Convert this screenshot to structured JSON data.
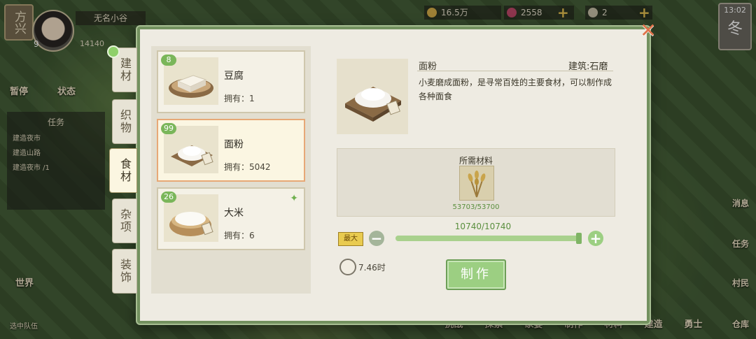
{
  "hud": {
    "season_left": "方兴",
    "player_name": "无名小谷",
    "level": "9",
    "coins_left": "14140",
    "resources": [
      {
        "value": "16.5万",
        "color": "#d9b04a"
      },
      {
        "value": "2558",
        "color": "#c24a6b"
      },
      {
        "value": "2",
        "color": "#c9c2aa"
      }
    ],
    "time": "13:02",
    "season": "冬"
  },
  "world": {
    "left_buttons": [
      "暂停",
      "状态"
    ],
    "task_panel": {
      "title": "任务",
      "rows": [
        "建造夜市",
        "建造山路",
        "建造夜市 /1"
      ]
    },
    "world_label": "世界",
    "squad_label": "选中队伍",
    "right_buttons": [
      "消息",
      "任务",
      "村民",
      "仓库"
    ],
    "bottom_menu": [
      "挑战",
      "探索",
      "家宴",
      "制作",
      "材料",
      "建造",
      "勇士"
    ]
  },
  "dialog": {
    "tabs": [
      "建材",
      "织物",
      "食材",
      "杂项",
      "装饰"
    ],
    "active_tab": 2,
    "items": [
      {
        "name": "豆腐",
        "owned_label": "拥有：1",
        "count": "8",
        "selected": false,
        "starred": false
      },
      {
        "name": "面粉",
        "owned_label": "拥有：5042",
        "count": "99",
        "selected": true,
        "starred": false
      },
      {
        "name": "大米",
        "owned_label": "拥有：6",
        "count": "26",
        "selected": false,
        "starred": true
      }
    ],
    "detail": {
      "name": "面粉",
      "building": "建筑:石磨",
      "description": "小麦磨成面粉，是寻常百姓的主要食材，可以制作成各种面食",
      "materials_title": "所需材料",
      "material_qty": "53703/53700",
      "ratio": "10740/10740",
      "max_label": "最大",
      "slider_fraction": 1.0,
      "duration": "7.46时",
      "make_label": "制作"
    }
  },
  "icons": {
    "close": "close-icon",
    "clock": "clock-icon",
    "wheat": "wheat-icon"
  }
}
